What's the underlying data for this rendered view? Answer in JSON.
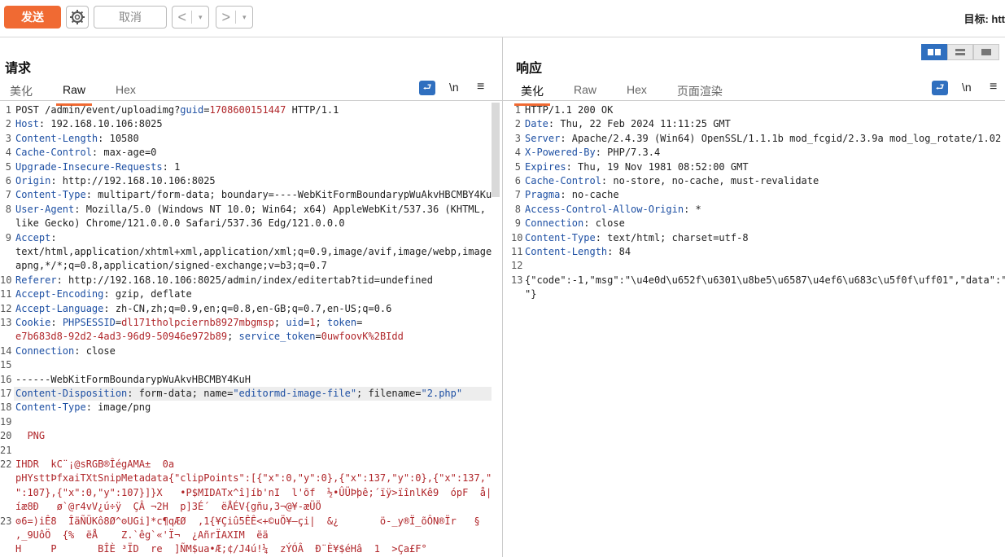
{
  "toolbar": {
    "send_label": "发送",
    "cancel_label": "取消",
    "back_arrow": "<",
    "forward_arrow": ">",
    "dropdown_arrow": "▾",
    "target_label": "目标: htt"
  },
  "request": {
    "title": "请求",
    "tabs": [
      "美化",
      "Raw",
      "Hex"
    ],
    "active_tab": "Raw",
    "newline_label": "\\n",
    "menu_label": "≡",
    "lines": [
      {
        "n": "1",
        "segs": [
          {
            "t": "POST /admin/event/uploadimg?"
          },
          {
            "t": "guid",
            "c": "hn"
          },
          {
            "t": "="
          },
          {
            "t": "1708600151447",
            "c": "val"
          },
          {
            "t": " HTTP/1.1"
          }
        ]
      },
      {
        "n": "2",
        "segs": [
          {
            "t": "Host",
            "c": "hn"
          },
          {
            "t": ": 192.168.10.106:8025"
          }
        ]
      },
      {
        "n": "3",
        "segs": [
          {
            "t": "Content-Length",
            "c": "hn"
          },
          {
            "t": ": 10580"
          }
        ]
      },
      {
        "n": "4",
        "segs": [
          {
            "t": "Cache-Control",
            "c": "hn"
          },
          {
            "t": ": max-age=0"
          }
        ]
      },
      {
        "n": "5",
        "segs": [
          {
            "t": "Upgrade-Insecure-Requests",
            "c": "hn"
          },
          {
            "t": ": 1"
          }
        ]
      },
      {
        "n": "6",
        "segs": [
          {
            "t": "Origin",
            "c": "hn"
          },
          {
            "t": ": http://192.168.10.106:8025"
          }
        ]
      },
      {
        "n": "7",
        "segs": [
          {
            "t": "Content-Type",
            "c": "hn"
          },
          {
            "t": ": multipart/form-data; boundary=----WebKitFormBoundarypWuAkvHBCMBY4KuH"
          }
        ]
      },
      {
        "n": "8",
        "segs": [
          {
            "t": "User-Agent",
            "c": "hn"
          },
          {
            "t": ": Mozilla/5.0 (Windows NT 10.0; Win64; x64) AppleWebKit/537.36 (KHTML,"
          }
        ]
      },
      {
        "n": "",
        "segs": [
          {
            "t": "like Gecko) Chrome/121.0.0.0 Safari/537.36 Edg/121.0.0.0"
          }
        ]
      },
      {
        "n": "9",
        "segs": [
          {
            "t": "Accept",
            "c": "hn"
          },
          {
            "t": ":"
          }
        ]
      },
      {
        "n": "",
        "segs": [
          {
            "t": "text/html,application/xhtml+xml,application/xml;q=0.9,image/avif,image/webp,image/"
          }
        ]
      },
      {
        "n": "",
        "segs": [
          {
            "t": "apng,*/*;q=0.8,application/signed-exchange;v=b3;q=0.7"
          }
        ]
      },
      {
        "n": "10",
        "segs": [
          {
            "t": "Referer",
            "c": "hn"
          },
          {
            "t": ": http://192.168.10.106:8025/admin/index/editertab?tid=undefined"
          }
        ]
      },
      {
        "n": "11",
        "segs": [
          {
            "t": "Accept-Encoding",
            "c": "hn"
          },
          {
            "t": ": gzip, deflate"
          }
        ]
      },
      {
        "n": "12",
        "segs": [
          {
            "t": "Accept-Language",
            "c": "hn"
          },
          {
            "t": ": zh-CN,zh;q=0.9,en;q=0.8,en-GB;q=0.7,en-US;q=0.6"
          }
        ]
      },
      {
        "n": "13",
        "segs": [
          {
            "t": "Cookie",
            "c": "hn"
          },
          {
            "t": ": "
          },
          {
            "t": "PHPSESSID",
            "c": "hn"
          },
          {
            "t": "="
          },
          {
            "t": "dl171tholpciernb8927mbgmsp",
            "c": "val"
          },
          {
            "t": "; "
          },
          {
            "t": "uid",
            "c": "hn"
          },
          {
            "t": "="
          },
          {
            "t": "1",
            "c": "val"
          },
          {
            "t": "; "
          },
          {
            "t": "token",
            "c": "hn"
          },
          {
            "t": "="
          }
        ]
      },
      {
        "n": "",
        "segs": [
          {
            "t": "e7b683d8-92d2-4ad3-96d9-50946e972b89",
            "c": "val"
          },
          {
            "t": "; "
          },
          {
            "t": "service_token",
            "c": "hn"
          },
          {
            "t": "="
          },
          {
            "t": "0uwfoovK%2BIdd",
            "c": "val"
          }
        ]
      },
      {
        "n": "14",
        "segs": [
          {
            "t": "Connection",
            "c": "hn"
          },
          {
            "t": ": close"
          }
        ]
      },
      {
        "n": "15",
        "segs": [
          {
            "t": ""
          }
        ]
      },
      {
        "n": "16",
        "segs": [
          {
            "t": "------WebKitFormBoundarypWuAkvHBCMBY4KuH"
          }
        ]
      },
      {
        "n": "17",
        "hl": true,
        "segs": [
          {
            "t": "Content-Disposition",
            "c": "hn"
          },
          {
            "t": ": form-data; name="
          },
          {
            "t": "\"editormd-image-file\"",
            "c": "hn"
          },
          {
            "t": "; filename="
          },
          {
            "t": "\"2.php\"",
            "c": "hn"
          }
        ]
      },
      {
        "n": "18",
        "segs": [
          {
            "t": "Content-Type",
            "c": "hn"
          },
          {
            "t": ": image/png"
          }
        ]
      },
      {
        "n": "19",
        "segs": [
          {
            "t": ""
          }
        ]
      },
      {
        "n": "20",
        "segs": [
          {
            "t": "  PNG",
            "c": "val"
          }
        ]
      },
      {
        "n": "21",
        "segs": [
          {
            "t": ""
          }
        ]
      },
      {
        "n": "22",
        "segs": [
          {
            "t": "IHDR  kC¨¡@sRGB®ÎégAMA±  0a",
            "c": "val"
          }
        ]
      },
      {
        "n": "",
        "segs": [
          {
            "t": "pHYsttÞfxaiTXtSnipMetadata{\"clipPoints\":[{\"x\":0,\"y\":0},{\"x\":137,\"y\":0},{\"x\":137,\"y",
            "c": "val"
          }
        ]
      },
      {
        "n": "",
        "segs": [
          {
            "t": "\":107},{\"x\":0,\"y\":107}]}X   •P$MIDATx^î]íb'nI  l'õf  ½•ÛÜÞþê;´ïÿ>ïînlKê9  ópF  å|",
            "c": "val"
          }
        ]
      },
      {
        "n": "",
        "segs": [
          {
            "t": "íæ8Ð   ø`@r4vV¿ú÷ÿ  ÇÂ ¬2H  p]3É´  ëÅÉV{gñu,3¬@¥-æÜÖ",
            "c": "val"
          }
        ]
      },
      {
        "n": "23",
        "segs": [
          {
            "t": "ʘ6=)iÊ8  ÎäÑÜKô8Ø^ʘUGi]*c¶qÆØ  ,1{¥Çiû5ÊÊ<+©uÖ¥—çi|  &¿       ö-_y®Ï_õÔN®Ïr   §",
            "c": "val"
          }
        ]
      },
      {
        "n": "",
        "segs": [
          {
            "t": ",_9UôÖ  {%  ëÅ    Z.`êg`«'Ï¬  ¿AñrÏAXIM  ëä",
            "c": "val"
          }
        ]
      },
      {
        "n": "",
        "segs": [
          {
            "t": "H     P       BÎÈ ³ÏD  re  ]ÑM$ua•Æ;¢/J4ú!¼  zÝÓÂ  Ð¨È¥$éHâ  1  >Ça£F°",
            "c": "val"
          }
        ]
      }
    ]
  },
  "response": {
    "title": "响应",
    "tabs": [
      "美化",
      "Raw",
      "Hex",
      "页面渲染"
    ],
    "active_tab": "美化",
    "newline_label": "\\n",
    "menu_label": "≡",
    "lines": [
      {
        "n": "1",
        "segs": [
          {
            "t": "HTTP/1.1 200 OK"
          }
        ]
      },
      {
        "n": "2",
        "segs": [
          {
            "t": "Date",
            "c": "hn"
          },
          {
            "t": ": Thu, 22 Feb 2024 11:11:25 GMT"
          }
        ]
      },
      {
        "n": "3",
        "segs": [
          {
            "t": "Server",
            "c": "hn"
          },
          {
            "t": ": Apache/2.4.39 (Win64) OpenSSL/1.1.1b mod_fcgid/2.3.9a mod_log_rotate/1.02"
          }
        ]
      },
      {
        "n": "4",
        "segs": [
          {
            "t": "X-Powered-By",
            "c": "hn"
          },
          {
            "t": ": PHP/7.3.4"
          }
        ]
      },
      {
        "n": "5",
        "segs": [
          {
            "t": "Expires",
            "c": "hn"
          },
          {
            "t": ": Thu, 19 Nov 1981 08:52:00 GMT"
          }
        ]
      },
      {
        "n": "6",
        "segs": [
          {
            "t": "Cache-Control",
            "c": "hn"
          },
          {
            "t": ": no-store, no-cache, must-revalidate"
          }
        ]
      },
      {
        "n": "7",
        "segs": [
          {
            "t": "Pragma",
            "c": "hn"
          },
          {
            "t": ": no-cache"
          }
        ]
      },
      {
        "n": "8",
        "segs": [
          {
            "t": "Access-Control-Allow-Origin",
            "c": "hn"
          },
          {
            "t": ": *"
          }
        ]
      },
      {
        "n": "9",
        "segs": [
          {
            "t": "Connection",
            "c": "hn"
          },
          {
            "t": ": close"
          }
        ]
      },
      {
        "n": "10",
        "segs": [
          {
            "t": "Content-Type",
            "c": "hn"
          },
          {
            "t": ": text/html; charset=utf-8"
          }
        ]
      },
      {
        "n": "11",
        "segs": [
          {
            "t": "Content-Length",
            "c": "hn"
          },
          {
            "t": ": 84"
          }
        ]
      },
      {
        "n": "12",
        "segs": [
          {
            "t": ""
          }
        ]
      },
      {
        "n": "13",
        "segs": [
          {
            "t": "{\"code\":-1,\"msg\":\"\\u4e0d\\u652f\\u6301\\u8be5\\u6587\\u4ef6\\u683c\\u5f0f\\uff01\",\"data\":\""
          }
        ]
      },
      {
        "n": "",
        "segs": [
          {
            "t": "\"}"
          }
        ]
      }
    ]
  }
}
